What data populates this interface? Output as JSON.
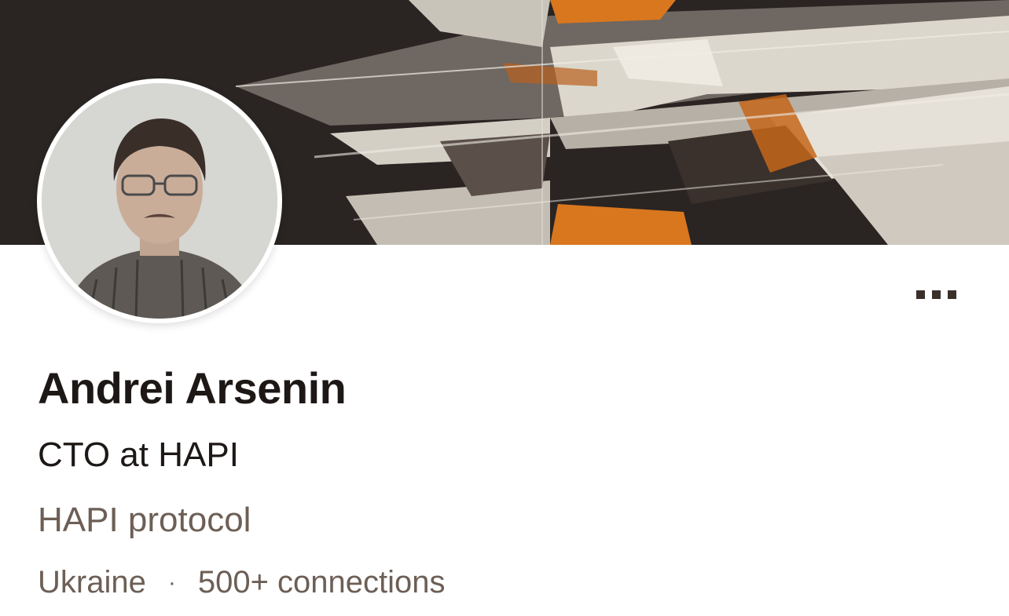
{
  "profile": {
    "name": "Andrei Arsenin",
    "headline": "CTO at HAPI",
    "company": "HAPI protocol",
    "location": "Ukraine",
    "separator": "·",
    "connections": "500+ connections"
  },
  "menu": {
    "more_icon": "more-horizontal-icon"
  },
  "colors": {
    "name_text": "#1d1816",
    "secondary_text": "#6d5f56",
    "cover_dark": "#2a2422",
    "cover_accent": "#d9771f"
  }
}
